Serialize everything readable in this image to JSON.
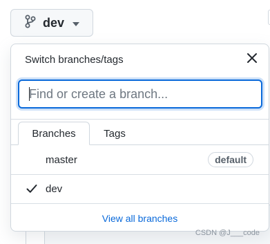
{
  "branch_button": {
    "label": "dev",
    "icon": "git-branch-icon"
  },
  "popover": {
    "title": "Switch branches/tags",
    "close_icon": "close-icon",
    "search": {
      "placeholder": "Find or create a branch...",
      "value": ""
    },
    "tabs": [
      {
        "label": "Branches",
        "active": true
      },
      {
        "label": "Tags",
        "active": false
      }
    ],
    "branches": [
      {
        "name": "master",
        "badge": "default",
        "selected": false
      },
      {
        "name": "dev",
        "badge": "",
        "selected": true
      }
    ],
    "footer_link": "View all branches"
  },
  "watermark": "CSDN @J___code",
  "colors": {
    "accent": "#0969da",
    "border": "#d0d7de",
    "text": "#24292f",
    "muted": "#57606a"
  }
}
